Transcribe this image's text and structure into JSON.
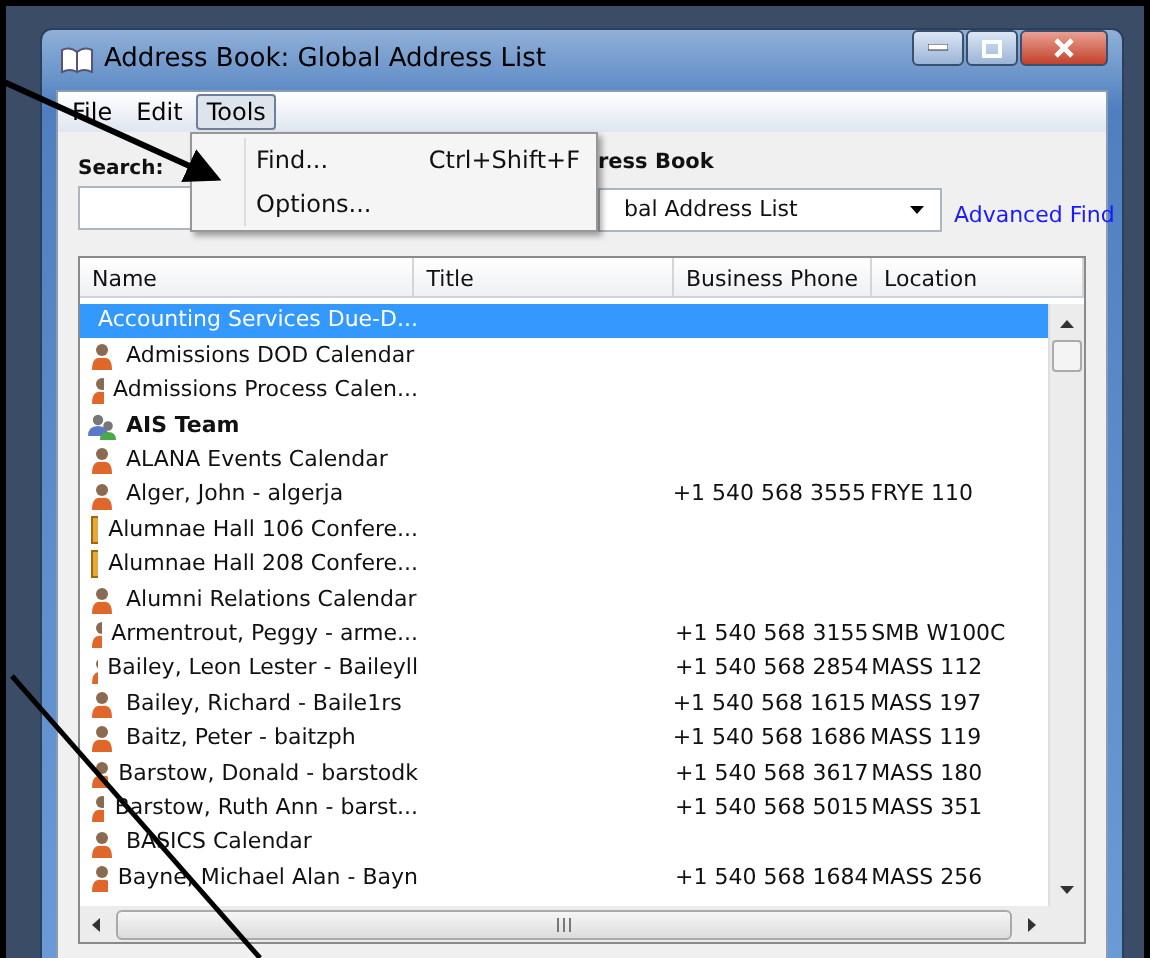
{
  "window": {
    "title": "Address Book: Global Address List"
  },
  "menu_bar": [
    {
      "label": "File",
      "selected": false
    },
    {
      "label": "Edit",
      "selected": false
    },
    {
      "label": "Tools",
      "selected": true
    }
  ],
  "open_menu": {
    "items": [
      {
        "label": "Find...",
        "shortcut": "Ctrl+Shift+F"
      },
      {
        "label": "Options..."
      }
    ]
  },
  "search": {
    "label": "Search:"
  },
  "address_book": {
    "label": "ress Book",
    "value": "bal Address List"
  },
  "advanced_find": "Advanced Find",
  "table": {
    "columns": [
      "Name",
      "Title",
      "Business Phone",
      "Location"
    ],
    "rows": [
      {
        "kind": "user",
        "name": "Accounting Services Due-D...",
        "selected": true
      },
      {
        "kind": "user",
        "name": "Admissions DOD Calendar",
        "selected": false
      },
      {
        "kind": "user",
        "name": "Admissions Process Calen...",
        "selected": false
      },
      {
        "kind": "group",
        "name": "AIS Team",
        "selected": false
      },
      {
        "kind": "user",
        "name": "ALANA Events Calendar",
        "selected": false
      },
      {
        "kind": "user",
        "name": "Alger, John - algerja",
        "phone": "+1 540 568 3555",
        "location": "FRYE 110",
        "selected": false
      },
      {
        "kind": "room",
        "name": "Alumnae Hall 106 Confere...",
        "selected": false
      },
      {
        "kind": "room",
        "name": "Alumnae Hall 208 Confere...",
        "selected": false
      },
      {
        "kind": "user",
        "name": "Alumni Relations Calendar",
        "selected": false
      },
      {
        "kind": "user",
        "name": "Armentrout, Peggy - arme...",
        "phone": "+1 540 568 3155",
        "location": "SMB W100C",
        "selected": false
      },
      {
        "kind": "user",
        "name": "Bailey, Leon Lester - Baileyll",
        "phone": "+1 540 568 2854",
        "location": "MASS 112",
        "selected": false
      },
      {
        "kind": "user",
        "name": "Bailey, Richard - Baile1rs",
        "phone": "+1 540 568 1615",
        "location": "MASS 197",
        "selected": false
      },
      {
        "kind": "user",
        "name": "Baitz, Peter - baitzph",
        "phone": "+1 540 568 1686",
        "location": "MASS 119",
        "selected": false
      },
      {
        "kind": "user",
        "name": "Barstow, Donald - barstodk",
        "phone": "+1 540 568 3617",
        "location": "MASS 180",
        "selected": false
      },
      {
        "kind": "user",
        "name": "Barstow, Ruth Ann - barst...",
        "phone": "+1 540 568 5015",
        "location": "MASS 351",
        "selected": false
      },
      {
        "kind": "user",
        "name": "BASICS Calendar",
        "selected": false
      },
      {
        "kind": "user",
        "name": "Bayne, Michael Alan - Bayn",
        "phone": "+1 540 568 1684",
        "location": "MASS 256",
        "selected": false
      }
    ]
  }
}
